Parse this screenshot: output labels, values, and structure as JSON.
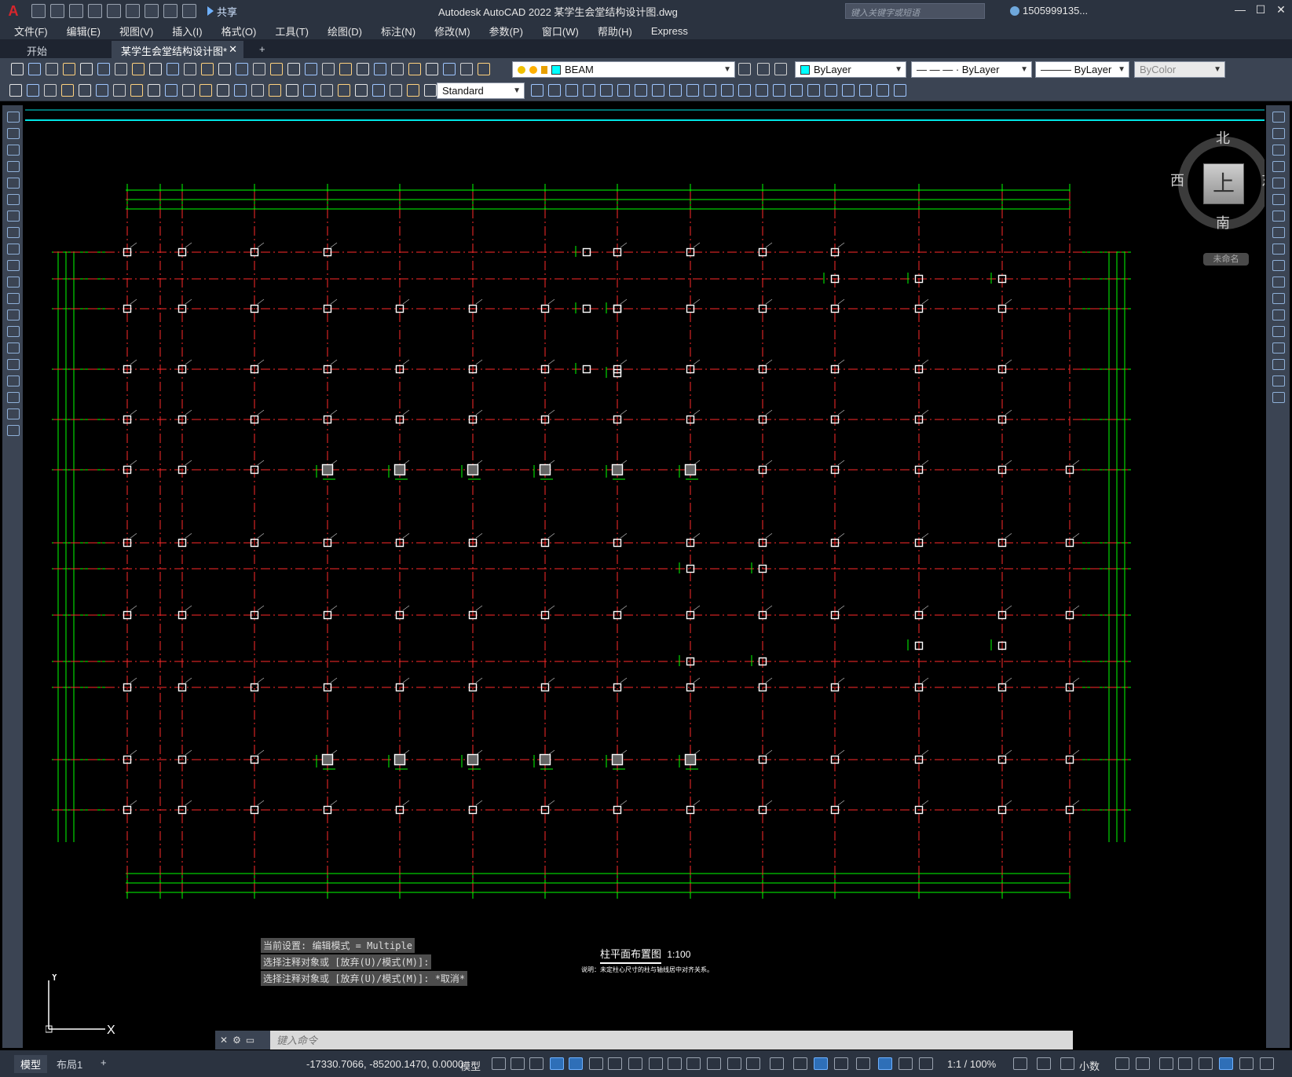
{
  "app": {
    "logo": "A",
    "title": "Autodesk AutoCAD 2022    某学生会堂结构设计图.dwg",
    "share_label": "共享",
    "search_placeholder": "键入关键字或短语",
    "user": "1505999135...",
    "win_min": "—",
    "win_max": "☐",
    "win_close": "✕"
  },
  "menu": [
    "文件(F)",
    "编辑(E)",
    "视图(V)",
    "插入(I)",
    "格式(O)",
    "工具(T)",
    "绘图(D)",
    "标注(N)",
    "修改(M)",
    "参数(P)",
    "窗口(W)",
    "帮助(H)",
    "Express"
  ],
  "tabs": {
    "start": "开始",
    "active": "某学生会堂结构设计图*",
    "close": "✕",
    "add": "+"
  },
  "toolbar": {
    "layer": "BEAM",
    "layer_color": "#00ffff",
    "color": "ByLayer",
    "linetype": "— — —  ·  ByLayer",
    "lineweight": "———  ByLayer",
    "plotstyle": "ByColor",
    "textstyle": "Standard"
  },
  "viewcube": {
    "north": "北",
    "south": "南",
    "east": "东",
    "west": "西",
    "face": "上",
    "ucs_menu": "未命名"
  },
  "ucs": {
    "x": "X",
    "y": "Y"
  },
  "drawing": {
    "caption_title": "柱平面布置图",
    "caption_scale": "1:100",
    "caption_note": "说明：未定柱心尺寸的柱与轴线居中对齐关系。",
    "colors": {
      "axis": "#ff2a2a",
      "dimension": "#00ff00",
      "column": "#ffffff",
      "frame": "#00e5e5"
    }
  },
  "command": {
    "history": [
      "当前设置: 编辑模式 = Multiple",
      "选择注释对象或 [放弃(U)/模式(M)]:",
      "选择注释对象或 [放弃(U)/模式(M)]: *取消*"
    ],
    "placeholder": "键入命令"
  },
  "status": {
    "model_tab": "模型",
    "layout_tab": "布局1",
    "add_tab": "+",
    "coords": "-17330.7066, -85200.1470, 0.0000",
    "model_space": "模型",
    "scale": "1:1 / 100%",
    "units": "小数"
  }
}
